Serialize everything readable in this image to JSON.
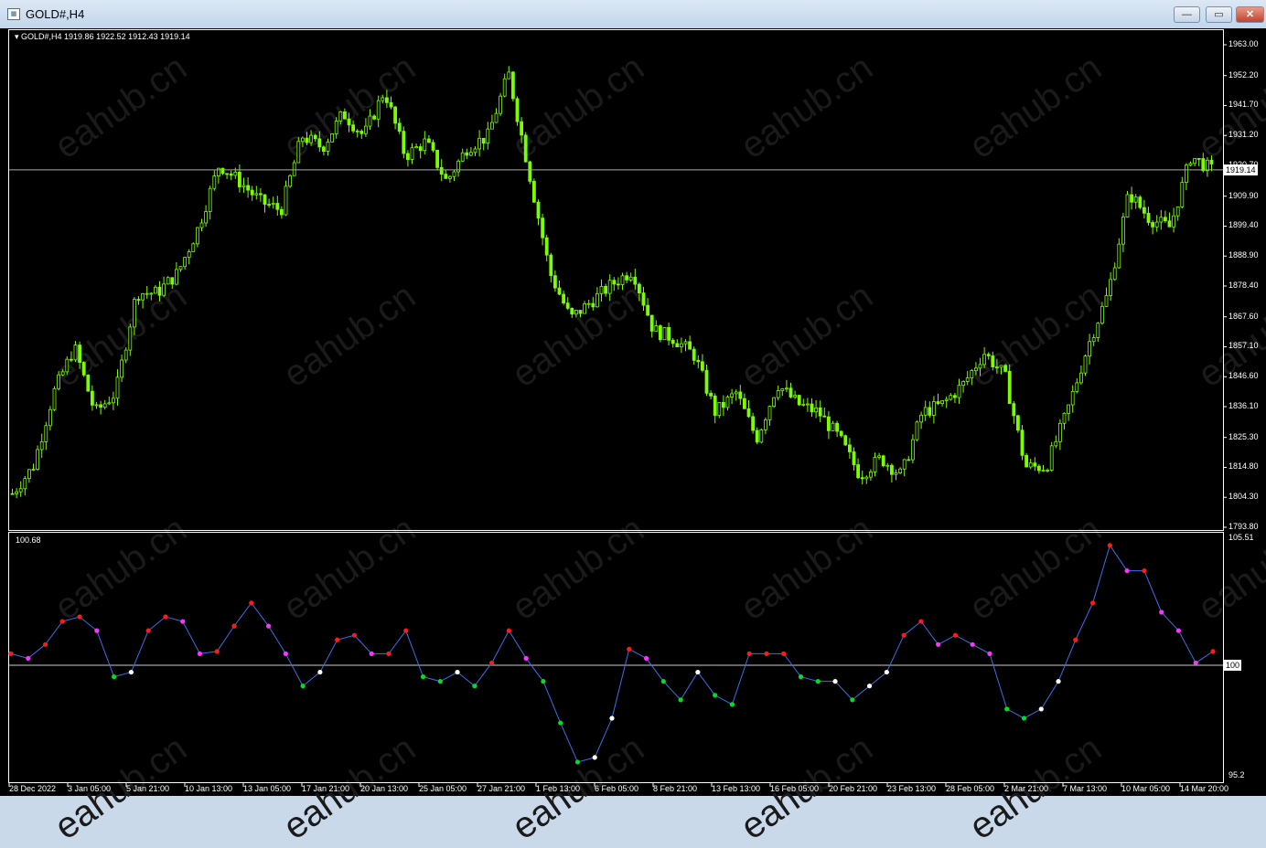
{
  "window": {
    "title": "GOLD#,H4",
    "minimize": "—",
    "maximize": "▭",
    "close": "✕"
  },
  "chart": {
    "info": "▾ GOLD#,H4  1919.86 1922.52 1912.43 1919.14",
    "current_price": "1919.14",
    "watermark": "eahub.cn",
    "price_axis": [
      "1963.00",
      "1952.20",
      "1941.70",
      "1931.20",
      "1920.70",
      "1909.90",
      "1899.40",
      "1888.90",
      "1878.40",
      "1867.60",
      "1857.10",
      "1846.60",
      "1836.10",
      "1825.30",
      "1814.80",
      "1804.30",
      "1793.80"
    ],
    "indicator_label": "100.68",
    "indicator_axis": [
      "105.51",
      "100",
      "95.2"
    ],
    "time_axis": [
      "28 Dec 2022",
      "3 Jan 05:00",
      "5 Jan 21:00",
      "10 Jan 13:00",
      "13 Jan 05:00",
      "17 Jan 21:00",
      "20 Jan 13:00",
      "25 Jan 05:00",
      "27 Jan 21:00",
      "1 Feb 13:00",
      "6 Feb 05:00",
      "8 Feb 21:00",
      "13 Feb 13:00",
      "16 Feb 05:00",
      "20 Feb 21:00",
      "23 Feb 13:00",
      "28 Feb 05:00",
      "2 Mar 21:00",
      "7 Mar 13:00",
      "10 Mar 05:00",
      "14 Mar 20:00"
    ],
    "colors": {
      "candle": "#7cfc00",
      "line": "#3a6fe8",
      "up_above": "#ff1a1a",
      "down_above": "#ff33ff",
      "down_below": "#00e020",
      "up_below": "#ffffff"
    }
  },
  "chart_data": {
    "type": "line",
    "title": "GOLD#,H4",
    "price_range": [
      1793.8,
      1963.0
    ],
    "price_closes": [
      1805.6,
      1815,
      1841,
      1857,
      1834,
      1841,
      1876,
      1876,
      1883,
      1899,
      1921,
      1915,
      1908,
      1905,
      1931,
      1927,
      1939,
      1931,
      1947,
      1924,
      1929,
      1915,
      1927,
      1931,
      1953,
      1918,
      1883,
      1867,
      1873,
      1879,
      1884,
      1863,
      1860,
      1854,
      1834,
      1841,
      1825,
      1844,
      1837,
      1834,
      1825,
      1812,
      1818,
      1812,
      1834,
      1837,
      1844,
      1855,
      1847,
      1815,
      1815,
      1834,
      1857,
      1876,
      1911,
      1902,
      1899,
      1924,
      1919.14
    ],
    "indicator_range": [
      95.2,
      105.51
    ],
    "indicator_values": [
      100.5,
      100.3,
      100.9,
      101.9,
      102.1,
      101.5,
      99.5,
      99.7,
      101.5,
      102.1,
      101.9,
      100.5,
      100.6,
      101.7,
      102.7,
      101.7,
      100.5,
      99.1,
      99.7,
      101.1,
      101.3,
      100.5,
      100.5,
      101.5,
      99.5,
      99.3,
      99.7,
      99.1,
      100.1,
      101.5,
      100.3,
      99.3,
      97.5,
      95.8,
      96.0,
      97.7,
      100.7,
      100.3,
      99.3,
      98.5,
      99.7,
      98.7,
      98.3,
      100.5,
      100.5,
      100.5,
      99.5,
      99.3,
      99.3,
      98.5,
      99.1,
      99.7,
      101.3,
      101.9,
      100.9,
      101.3,
      100.9,
      100.5,
      98.1,
      97.7,
      98.1,
      99.3,
      101.1,
      102.7,
      105.2,
      104.1,
      104.1,
      102.3,
      101.5,
      100.1,
      100.6
    ]
  }
}
